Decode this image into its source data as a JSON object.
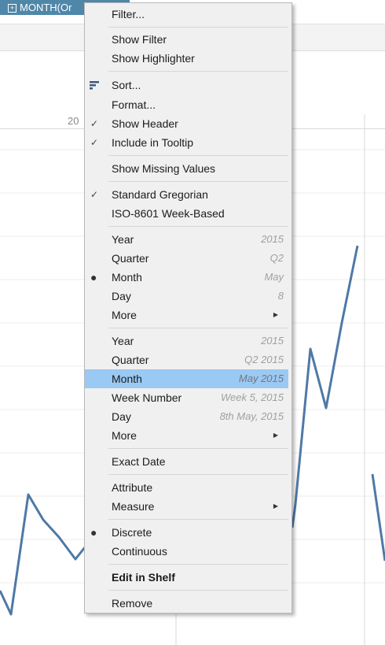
{
  "shelf_pill": {
    "label": "MONTH(Or",
    "expand_icon": "plus-box-icon"
  },
  "header_tick": "20",
  "colors": {
    "pill": "#4f87a8",
    "line": "#4e79a7",
    "highlight": "#9ac9f3",
    "menu_bg": "#f0f0f0"
  },
  "context_menu": {
    "filter": "Filter...",
    "show_filter": "Show Filter",
    "show_highlighter": "Show Highlighter",
    "sort": "Sort...",
    "format": "Format...",
    "show_header": "Show Header",
    "include_tooltip": "Include in Tooltip",
    "show_missing": "Show Missing Values",
    "standard_gregorian": "Standard Gregorian",
    "iso_week": "ISO-8601 Week-Based",
    "date_part": {
      "year": {
        "label": "Year",
        "value": "2015"
      },
      "quarter": {
        "label": "Quarter",
        "value": "Q2"
      },
      "month": {
        "label": "Month",
        "value": "May"
      },
      "day": {
        "label": "Day",
        "value": "8"
      },
      "more": "More"
    },
    "date_value": {
      "year": {
        "label": "Year",
        "value": "2015"
      },
      "quarter": {
        "label": "Quarter",
        "value": "Q2 2015"
      },
      "month": {
        "label": "Month",
        "value": "May 2015"
      },
      "week": {
        "label": "Week Number",
        "value": "Week 5, 2015"
      },
      "day": {
        "label": "Day",
        "value": "8th May, 2015"
      },
      "more": "More"
    },
    "exact_date": "Exact Date",
    "attribute": "Attribute",
    "measure": "Measure",
    "discrete": "Discrete",
    "continuous": "Continuous",
    "edit_in_shelf": "Edit in Shelf",
    "remove": "Remove",
    "checked_items": [
      "Show Header",
      "Include in Tooltip",
      "Standard Gregorian"
    ],
    "selected_items": [
      "Month",
      "Discrete"
    ],
    "highlighted_item": "Month"
  }
}
